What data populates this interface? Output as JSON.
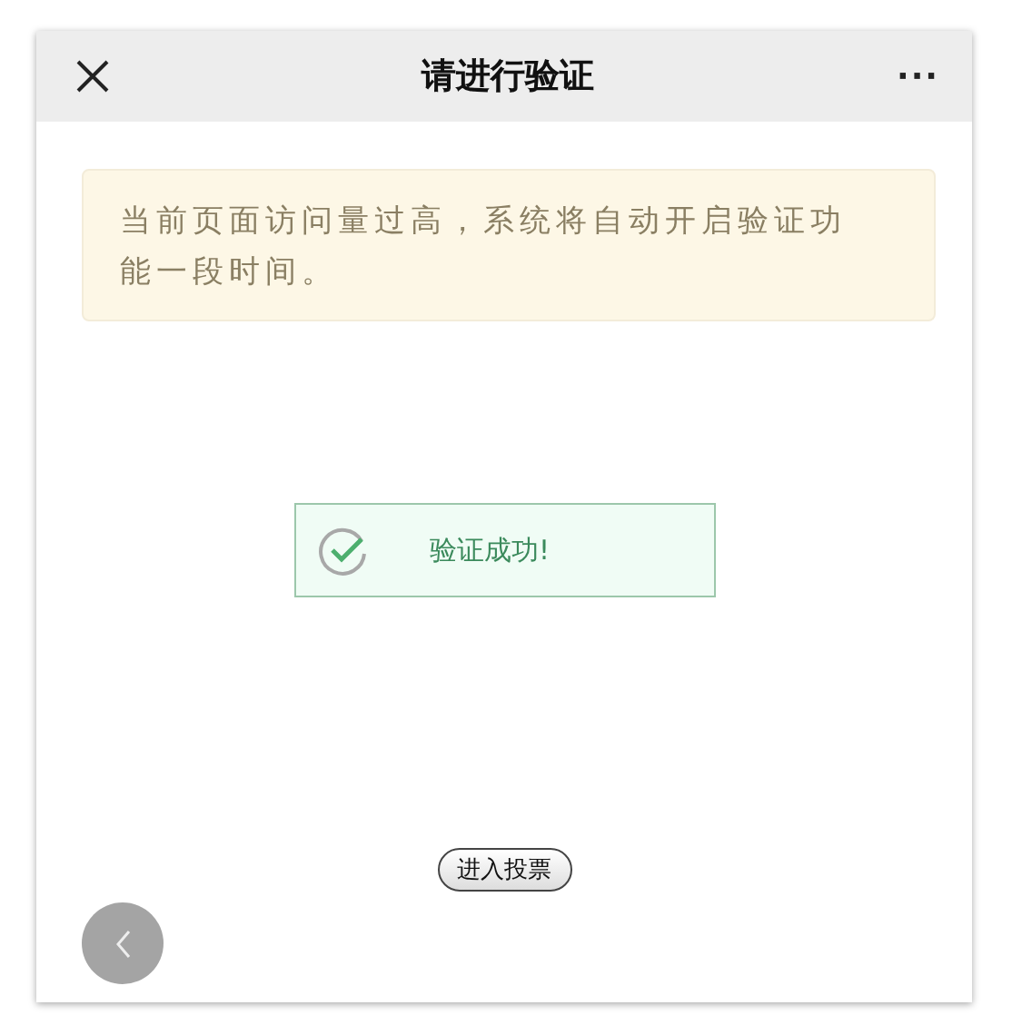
{
  "header": {
    "title": "请进行验证",
    "more_icon": "···"
  },
  "notice": {
    "text": "当前页面访问量过高，系统将自动开启验证功能一段时间。"
  },
  "status": {
    "text": "验证成功!",
    "success": true
  },
  "vote_button": {
    "label": "进入投票"
  }
}
